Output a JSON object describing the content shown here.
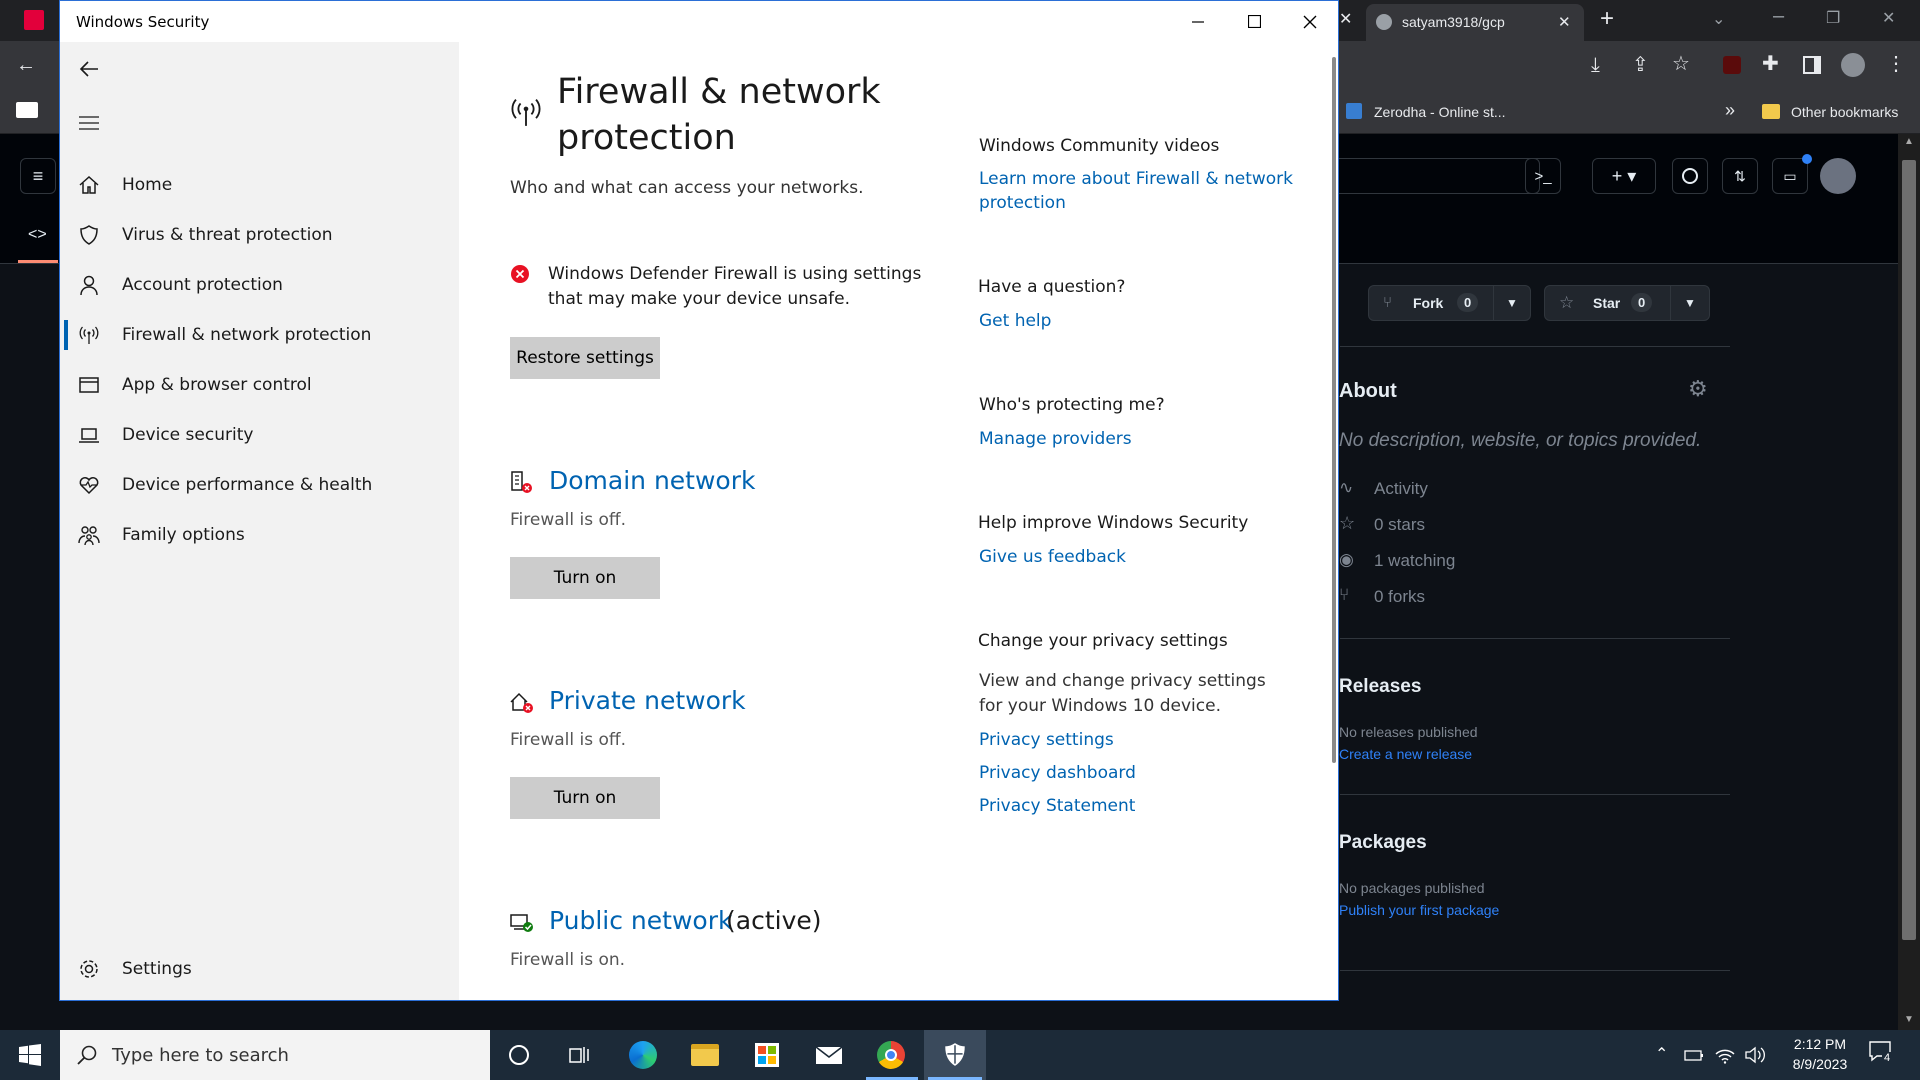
{
  "browser": {
    "tab_title": "satyam3918/gcp",
    "bookmarks": {
      "zerodha": "Zerodha - Online st...",
      "overflow": "»",
      "other": "Other bookmarks"
    }
  },
  "github": {
    "fork_label": "Fork",
    "fork_count": "0",
    "star_label": "Star",
    "star_count": "0",
    "about_heading": "About",
    "about_desc": "No description, website, or topics provided.",
    "stats": [
      "Activity",
      "0 stars",
      "1 watching",
      "0 forks"
    ],
    "releases_heading": "Releases",
    "releases_empty": "No releases published",
    "releases_link": "Create a new release",
    "packages_heading": "Packages",
    "packages_empty": "No packages published",
    "packages_link": "Publish your first package"
  },
  "window": {
    "title": "Windows Security"
  },
  "sidebar": {
    "items": [
      {
        "label": "Home",
        "icon": "home-icon"
      },
      {
        "label": "Virus & threat protection",
        "icon": "shield-icon"
      },
      {
        "label": "Account protection",
        "icon": "person-icon"
      },
      {
        "label": "Firewall & network protection",
        "icon": "antenna-icon"
      },
      {
        "label": "App & browser control",
        "icon": "browser-window-icon"
      },
      {
        "label": "Device security",
        "icon": "laptop-icon"
      },
      {
        "label": "Device performance & health",
        "icon": "heart-icon"
      },
      {
        "label": "Family options",
        "icon": "family-icon"
      }
    ],
    "selected_index": 3,
    "settings_label": "Settings"
  },
  "main": {
    "title_line1": "Firewall & network",
    "title_line2": "protection",
    "subtitle": "Who and what can access your networks.",
    "warning_line1": "Windows Defender Firewall is using settings",
    "warning_line2": "that may make your device unsafe.",
    "restore_label": "Restore settings",
    "networks": [
      {
        "name": "Domain network",
        "suffix": "",
        "status": "Firewall is off.",
        "button": "Turn on"
      },
      {
        "name": "Private network",
        "suffix": "",
        "status": "Firewall is off.",
        "button": "Turn on"
      },
      {
        "name": "Public network",
        "suffix": "(active)",
        "status": "Firewall is on.",
        "button": ""
      }
    ]
  },
  "right": {
    "community_heading": "Windows Community videos",
    "community_link_line1": "Learn more about Firewall & network",
    "community_link_line2": "protection",
    "question_heading": "Have a question?",
    "question_link": "Get help",
    "protecting_heading": "Who's protecting me?",
    "protecting_link": "Manage providers",
    "improve_heading": "Help improve Windows Security",
    "improve_link": "Give us feedback",
    "privacy_heading": "Change your privacy settings",
    "privacy_desc_line1": "View and change privacy settings",
    "privacy_desc_line2": "for your Windows 10 device.",
    "privacy_links": [
      "Privacy settings",
      "Privacy dashboard",
      "Privacy Statement"
    ]
  },
  "taskbar": {
    "search_placeholder": "Type here to search",
    "time": "2:12 PM",
    "date": "8/9/2023",
    "notification_count": "4"
  },
  "colors": {
    "accent": "#0063b1",
    "error": "#e81123",
    "ok": "#107c10"
  }
}
